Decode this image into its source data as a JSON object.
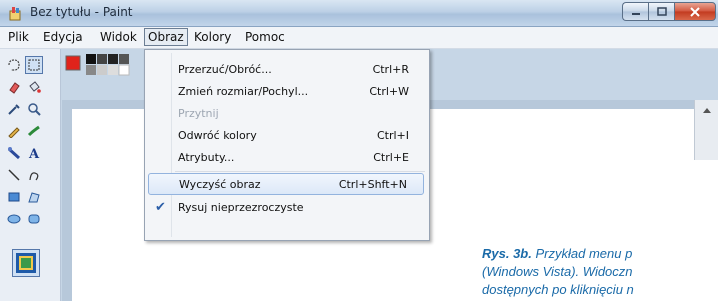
{
  "window": {
    "title": "Bez tytułu - Paint"
  },
  "menubar": {
    "items": [
      "Plik",
      "Edycja",
      "Widok",
      "Obraz",
      "Kolory",
      "Pomoc"
    ],
    "active": "Obraz"
  },
  "dropdown": {
    "items": [
      {
        "label": "Przerzuć/Obróć...",
        "shortcut": "Ctrl+R",
        "state": "normal"
      },
      {
        "label": "Zmień rozmiar/Pochyl...",
        "shortcut": "Ctrl+W",
        "state": "normal"
      },
      {
        "label": "Przytnij",
        "shortcut": "",
        "state": "disabled"
      },
      {
        "label": "Odwróć kolory",
        "shortcut": "Ctrl+I",
        "state": "normal"
      },
      {
        "label": "Atrybuty...",
        "shortcut": "Ctrl+E",
        "state": "normal"
      },
      {
        "label": "Wyczyść obraz",
        "shortcut": "Ctrl+Shft+N",
        "state": "highlighted"
      },
      {
        "label": "Rysuj nieprzezroczyste",
        "shortcut": "",
        "state": "checked"
      }
    ]
  },
  "caption": {
    "label": "Rys. 3b.",
    "line1": "Przykład menu p",
    "line2": "(Windows Vista). Widoczn",
    "line3": "dostępnych po kliknięciu n"
  },
  "colors": {
    "caption_text": "#1a6aa8",
    "menu_highlight_border": "#93b3de",
    "primary_color": "#e0231b"
  },
  "icons": {
    "tools": [
      "free-select-icon",
      "rect-select-icon",
      "eraser-icon",
      "fill-bucket-icon",
      "color-picker-icon",
      "magnifier-icon",
      "pencil-icon",
      "brush-icon",
      "airbrush-icon",
      "text-icon",
      "line-icon",
      "curve-icon",
      "rectangle-icon",
      "polygon-icon",
      "ellipse-icon",
      "rounded-rect-icon"
    ]
  }
}
